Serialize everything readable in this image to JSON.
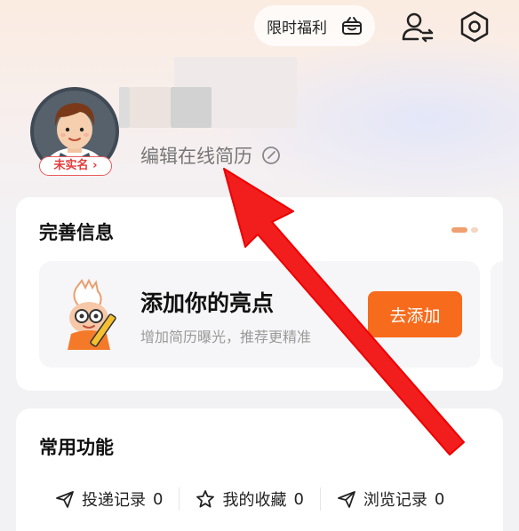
{
  "topbar": {
    "benefit_label": "限时福利",
    "icons": [
      "gift-icon",
      "user-switch-icon",
      "settings-icon"
    ]
  },
  "profile": {
    "verify_badge": "未实名",
    "edit_resume": "编辑在线简历"
  },
  "info_card": {
    "title": "完善信息",
    "highlight_title": "添加你的亮点",
    "highlight_sub": "增加简历曝光，推荐更精准",
    "add_button": "去添加"
  },
  "functions_card": {
    "title": "常用功能",
    "items": [
      {
        "label": "投递记录",
        "count": "0",
        "icon": "send-icon"
      },
      {
        "label": "我的收藏",
        "count": "0",
        "icon": "star-icon"
      },
      {
        "label": "浏览记录",
        "count": "0",
        "icon": "history-icon"
      }
    ]
  },
  "colors": {
    "accent": "#f76b1c",
    "badge_red": "#e33a3a",
    "arrow_red": "#f21d1d"
  }
}
